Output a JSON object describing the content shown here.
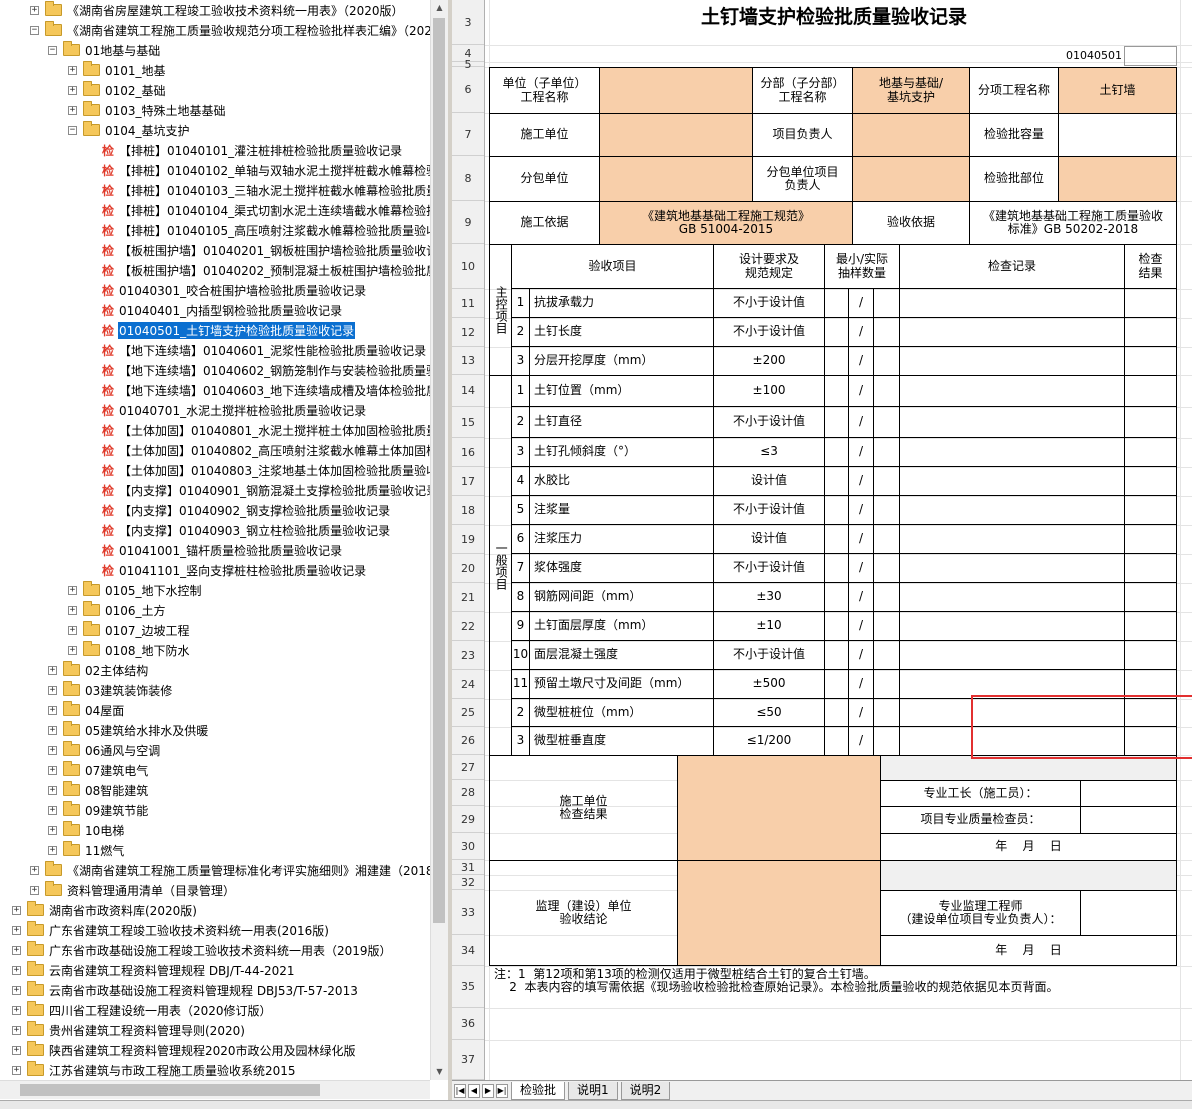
{
  "tree": {
    "items": [
      {
        "level": 3,
        "expander": "+",
        "icon": "folder",
        "text": "《湖南省房屋建筑工程竣工验收技术资料统一用表》（2020版）"
      },
      {
        "level": 3,
        "expander": "-",
        "icon": "folder",
        "text": "《湖南省建筑工程施工质量验收规范分项工程检验批样表汇编》（2020"
      },
      {
        "level": 4,
        "expander": "-",
        "icon": "folder",
        "text": "01地基与基础"
      },
      {
        "level": 5,
        "expander": "+",
        "icon": "folder",
        "text": "0101_地基"
      },
      {
        "level": 5,
        "expander": "+",
        "icon": "folder",
        "text": "0102_基础"
      },
      {
        "level": 5,
        "expander": "+",
        "icon": "folder",
        "text": "0103_特殊土地基基础"
      },
      {
        "level": 5,
        "expander": "-",
        "icon": "folder",
        "text": "0104_基坑支护"
      },
      {
        "level": 6,
        "expander": "",
        "icon": "jian",
        "text": "【排桩】01040101_灌注桩排桩检验批质量验收记录"
      },
      {
        "level": 6,
        "expander": "",
        "icon": "jian",
        "text": "【排桩】01040102_单轴与双轴水泥土搅拌桩截水帷幕检验"
      },
      {
        "level": 6,
        "expander": "",
        "icon": "jian",
        "text": "【排桩】01040103_三轴水泥土搅拌桩截水帷幕检验批质量"
      },
      {
        "level": 6,
        "expander": "",
        "icon": "jian",
        "text": "【排桩】01040104_渠式切割水泥土连续墙截水帷幕检验批"
      },
      {
        "level": 6,
        "expander": "",
        "icon": "jian",
        "text": "【排桩】01040105_高压喷射注浆截水帷幕检验批质量验收"
      },
      {
        "level": 6,
        "expander": "",
        "icon": "jian",
        "text": "【板桩围护墙】01040201_钢板桩围护墙检验批质量验收记"
      },
      {
        "level": 6,
        "expander": "",
        "icon": "jian",
        "text": "【板桩围护墙】01040202_预制混凝土板桩围护墙检验批质"
      },
      {
        "level": 6,
        "expander": "",
        "icon": "jian",
        "text": "01040301_咬合桩围护墙检验批质量验收记录"
      },
      {
        "level": 6,
        "expander": "",
        "icon": "jian",
        "text": "01040401_内插型钢检验批质量验收记录"
      },
      {
        "level": 6,
        "expander": "",
        "icon": "jian",
        "text": "01040501_土钉墙支护检验批质量验收记录",
        "selected": true
      },
      {
        "level": 6,
        "expander": "",
        "icon": "jian",
        "text": "【地下连续墙】01040601_泥浆性能检验批质量验收记录"
      },
      {
        "level": 6,
        "expander": "",
        "icon": "jian",
        "text": "【地下连续墙】01040602_钢筋笼制作与安装检验批质量验"
      },
      {
        "level": 6,
        "expander": "",
        "icon": "jian",
        "text": "【地下连续墙】01040603_地下连续墙成槽及墙体检验批质"
      },
      {
        "level": 6,
        "expander": "",
        "icon": "jian",
        "text": "01040701_水泥土搅拌桩检验批质量验收记录"
      },
      {
        "level": 6,
        "expander": "",
        "icon": "jian",
        "text": "【土体加固】01040801_水泥土搅拌桩土体加固检验批质量"
      },
      {
        "level": 6,
        "expander": "",
        "icon": "jian",
        "text": "【土体加固】01040802_高压喷射注浆截水帷幕土体加固检"
      },
      {
        "level": 6,
        "expander": "",
        "icon": "jian",
        "text": "【土体加固】01040803_注浆地基土体加固检验批质量验收"
      },
      {
        "level": 6,
        "expander": "",
        "icon": "jian",
        "text": "【内支撑】01040901_钢筋混凝土支撑检验批质量验收记录"
      },
      {
        "level": 6,
        "expander": "",
        "icon": "jian",
        "text": "【内支撑】01040902_钢支撑检验批质量验收记录"
      },
      {
        "level": 6,
        "expander": "",
        "icon": "jian",
        "text": "【内支撑】01040903_钢立柱检验批质量验收记录"
      },
      {
        "level": 6,
        "expander": "",
        "icon": "jian",
        "text": "01041001_锚杆质量检验批质量验收记录"
      },
      {
        "level": 6,
        "expander": "",
        "icon": "jian",
        "text": "01041101_竖向支撑桩柱检验批质量验收记录"
      },
      {
        "level": 5,
        "expander": "+",
        "icon": "folder",
        "text": "0105_地下水控制"
      },
      {
        "level": 5,
        "expander": "+",
        "icon": "folder",
        "text": "0106_土方"
      },
      {
        "level": 5,
        "expander": "+",
        "icon": "folder",
        "text": "0107_边坡工程"
      },
      {
        "level": 5,
        "expander": "+",
        "icon": "folder",
        "text": "0108_地下防水"
      },
      {
        "level": 4,
        "expander": "+",
        "icon": "folder",
        "text": "02主体结构"
      },
      {
        "level": 4,
        "expander": "+",
        "icon": "folder",
        "text": "03建筑装饰装修"
      },
      {
        "level": 4,
        "expander": "+",
        "icon": "folder",
        "text": "04屋面"
      },
      {
        "level": 4,
        "expander": "+",
        "icon": "folder",
        "text": "05建筑给水排水及供暖"
      },
      {
        "level": 4,
        "expander": "+",
        "icon": "folder",
        "text": "06通风与空调"
      },
      {
        "level": 4,
        "expander": "+",
        "icon": "folder",
        "text": "07建筑电气"
      },
      {
        "level": 4,
        "expander": "+",
        "icon": "folder",
        "text": "08智能建筑"
      },
      {
        "level": 4,
        "expander": "+",
        "icon": "folder",
        "text": "09建筑节能"
      },
      {
        "level": 4,
        "expander": "+",
        "icon": "folder",
        "text": "10电梯"
      },
      {
        "level": 4,
        "expander": "+",
        "icon": "folder",
        "text": "11燃气"
      },
      {
        "level": 3,
        "expander": "+",
        "icon": "folder",
        "text": "《湖南省建筑工程施工质量管理标准化考评实施细则》湘建建（2018）"
      },
      {
        "level": 3,
        "expander": "+",
        "icon": "folder",
        "text": "资料管理通用清单（目录管理）"
      },
      {
        "level": 1,
        "expander": "+",
        "icon": "folder",
        "text": "湖南省市政资料库(2020版)"
      },
      {
        "level": 1,
        "expander": "+",
        "icon": "folder",
        "text": "广东省建筑工程竣工验收技术资料统一用表(2016版)"
      },
      {
        "level": 1,
        "expander": "+",
        "icon": "folder",
        "text": "广东省市政基础设施工程竣工验收技术资料统一用表（2019版）"
      },
      {
        "level": 1,
        "expander": "+",
        "icon": "folder",
        "text": "云南省建筑工程资料管理规程 DBJ/T-44-2021"
      },
      {
        "level": 1,
        "expander": "+",
        "icon": "folder",
        "text": "云南省市政基础设施工程资料管理规程 DBJ53/T-57-2013"
      },
      {
        "level": 1,
        "expander": "+",
        "icon": "folder",
        "text": "四川省工程建设统一用表（2020修订版）"
      },
      {
        "level": 1,
        "expander": "+",
        "icon": "folder",
        "text": "贵州省建筑工程资料管理导则(2020)"
      },
      {
        "level": 1,
        "expander": "+",
        "icon": "folder",
        "text": "陕西省建筑工程资料管理规程2020市政公用及园林绿化版"
      },
      {
        "level": 1,
        "expander": "+",
        "icon": "folder",
        "text": "江苏省建筑与市政工程施工质量验收系统2015"
      }
    ]
  },
  "sheet": {
    "row_numbers": [
      "3",
      "4",
      "5",
      "6",
      "7",
      "8",
      "9",
      "10",
      "11",
      "12",
      "13",
      "14",
      "15",
      "16",
      "17",
      "18",
      "19",
      "20",
      "21",
      "22",
      "23",
      "24",
      "25",
      "26",
      "27",
      "28",
      "29",
      "30",
      "31",
      "32",
      "33",
      "34",
      "35",
      "36",
      "37"
    ],
    "title": "土钉墙支护检验批质量验收记录",
    "code": "01040501",
    "header": {
      "unit_label": "单位（子单位）\n工程名称",
      "division_label": "分部（子分部）\n工程名称",
      "division_value": "地基与基础/\n基坑支护",
      "subitem_label": "分项工程名称",
      "subitem_value": "土钉墙",
      "contractor_label": "施工单位",
      "pm_label": "项目负责人",
      "capacity_label": "检验批容量",
      "subcontractor_label": "分包单位",
      "sub_pm_label": "分包单位项目\n负责人",
      "location_label": "检验批部位",
      "basis_label": "施工依据",
      "basis_value": "《建筑地基基础工程施工规范》\nGB 51004-2015",
      "acceptance_label": "验收依据",
      "acceptance_value": "《建筑地基基础工程施工质量验收\n标准》GB 50202-2018"
    },
    "col_headers": {
      "item": "验收项目",
      "req": "设计要求及\n规范规定",
      "sample": "最小/实际\n抽样数量",
      "record": "检查记录",
      "result": "检查\n结果"
    },
    "main_label": "主控项目",
    "general_label": "一般项目",
    "main_items": [
      {
        "no": "1",
        "name": "抗拔承载力",
        "req": "不小于设计值",
        "slash": "/"
      },
      {
        "no": "2",
        "name": "土钉长度",
        "req": "不小于设计值",
        "slash": "/"
      },
      {
        "no": "3",
        "name": "分层开挖厚度（mm）",
        "req": "±200",
        "slash": "/"
      }
    ],
    "general_items": [
      {
        "no": "1",
        "name": "土钉位置（mm）",
        "req": "±100",
        "slash": "/"
      },
      {
        "no": "2",
        "name": "土钉直径",
        "req": "不小于设计值",
        "slash": "/"
      },
      {
        "no": "3",
        "name": "土钉孔倾斜度（°）",
        "req": "≤3",
        "slash": "/"
      },
      {
        "no": "4",
        "name": "水胶比",
        "req": "设计值",
        "slash": "/"
      },
      {
        "no": "5",
        "name": "注浆量",
        "req": "不小于设计值",
        "slash": "/"
      },
      {
        "no": "6",
        "name": "注浆压力",
        "req": "设计值",
        "slash": "/"
      },
      {
        "no": "7",
        "name": "浆体强度",
        "req": "不小于设计值",
        "slash": "/"
      },
      {
        "no": "8",
        "name": "钢筋网间距（mm）",
        "req": "±30",
        "slash": "/"
      },
      {
        "no": "9",
        "name": "土钉面层厚度（mm）",
        "req": "±10",
        "slash": "/"
      },
      {
        "no": "10",
        "name": "面层混凝土强度",
        "req": "不小于设计值",
        "slash": "/"
      },
      {
        "no": "11",
        "name": "预留土墩尺寸及间距（mm）",
        "req": "±500",
        "slash": "/"
      },
      {
        "no": "2",
        "name": "微型桩桩位（mm）",
        "req": "≤50",
        "slash": "/"
      },
      {
        "no": "3",
        "name": "微型桩垂直度",
        "req": "≤1/200",
        "slash": "/"
      }
    ],
    "contractor_check": "施工单位\n检查结果",
    "foreman_label": "专业工长（施工员）：",
    "inspector_label": "项目专业质量检查员：",
    "date_label": "年    月    日",
    "supervisor_label": "监理（建设）单位\n验收结论",
    "engineer_label": "专业监理工程师\n（建设单位项目专业负责人）：",
    "date_label2": "年    月    日",
    "notes": "注：1  第12项和第13项的检测仅适用于微型桩结合土钉的复合土钉墙。\n    2  本表内容的填写需依据《现场验收检验批检查原始记录》。本检验批质量验收的规范依据见本页背面。"
  },
  "tabs": [
    "检验批",
    "说明1",
    "说明2"
  ],
  "colors": {
    "peach": "#f8cfaa",
    "selection": "#0b6fd0",
    "highlight_box": "#e23030"
  }
}
